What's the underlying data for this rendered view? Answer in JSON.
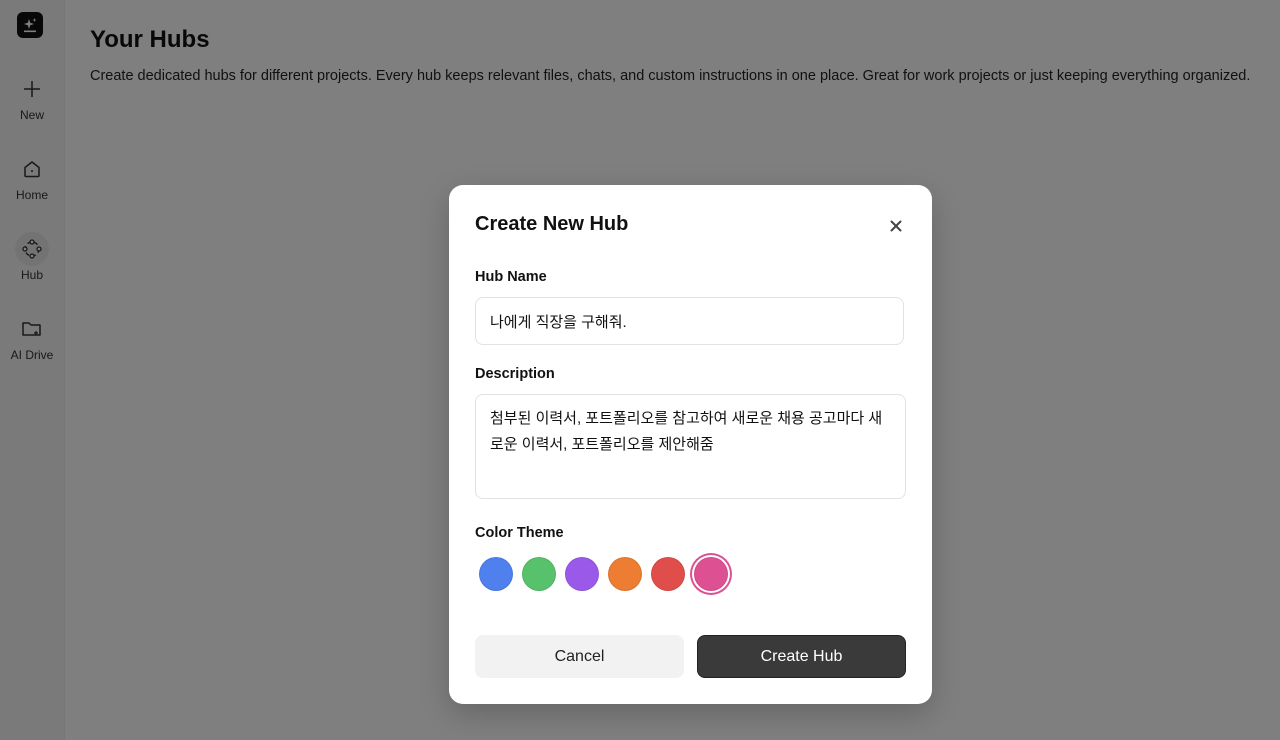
{
  "sidebar": {
    "items": [
      {
        "label": "New",
        "icon": "plus-icon"
      },
      {
        "label": "Home",
        "icon": "home-icon"
      },
      {
        "label": "Hub",
        "icon": "hub-icon",
        "active": true
      },
      {
        "label": "AI Drive",
        "icon": "folder-icon"
      }
    ]
  },
  "page": {
    "title": "Your Hubs",
    "description": "Create dedicated hubs for different projects. Every hub keeps relevant files, chats, and custom instructions in one place. Great for work projects or just keeping everything organized."
  },
  "modal": {
    "title": "Create New Hub",
    "name_label": "Hub Name",
    "name_value": "나에게 직장을 구해줘.",
    "description_label": "Description",
    "description_value": "첨부된 이력서, 포트폴리오를 참고하여 새로운 채용 공고마다 새로운 이력서, 포트폴리오를 제안해줌",
    "color_label": "Color Theme",
    "colors": [
      "#4f80ee",
      "#57c26b",
      "#9b59ea",
      "#ec7d33",
      "#e04e4b",
      "#dd5193"
    ],
    "selected_color": "#dd5193",
    "cancel_label": "Cancel",
    "create_label": "Create Hub"
  }
}
